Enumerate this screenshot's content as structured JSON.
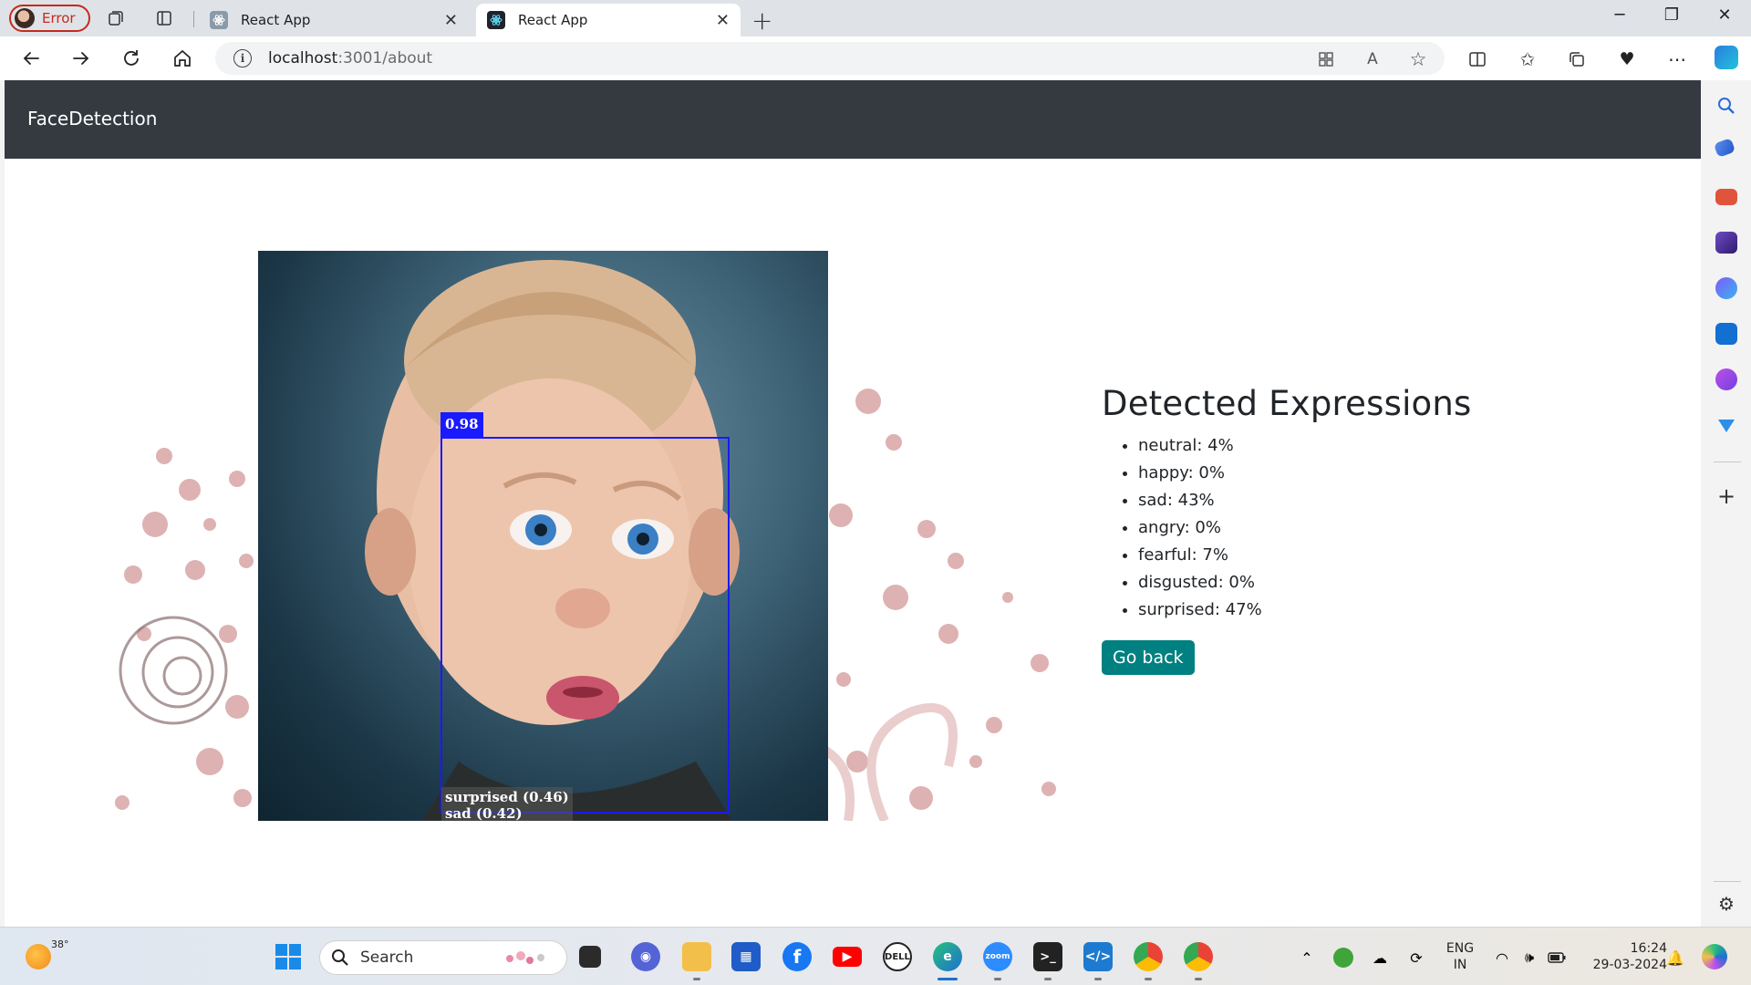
{
  "browser": {
    "profile_label": "Error",
    "tabs": [
      {
        "title": "React App",
        "active": false
      },
      {
        "title": "React App",
        "active": true
      }
    ],
    "url_host": "localhost",
    "url_path": ":3001/about"
  },
  "app": {
    "brand": "FaceDetection"
  },
  "detection": {
    "score_label": "0.98",
    "label_line1": "surprised (0.46)",
    "label_line2": "sad (0.42)"
  },
  "expressions": {
    "heading": "Detected Expressions",
    "items": [
      "neutral: 4%",
      "happy: 0%",
      "sad: 43%",
      "angry: 0%",
      "fearful: 7%",
      "disgusted: 0%",
      "surprised: 47%"
    ],
    "button_label": "Go back"
  },
  "taskbar": {
    "weather_temp": "38°",
    "search_placeholder": "Search",
    "lang_line1": "ENG",
    "lang_line2": "IN",
    "time": "16:24",
    "date": "29-03-2024"
  },
  "colors": {
    "navbar_bg": "#343a40",
    "button_bg": "#008080",
    "detection_box": "#1a1aff"
  }
}
